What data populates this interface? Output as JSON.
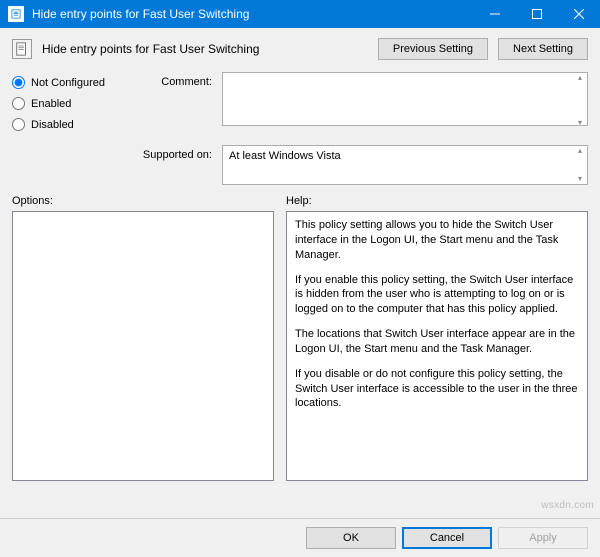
{
  "window": {
    "title": "Hide entry points for Fast User Switching"
  },
  "header": {
    "page_title": "Hide entry points for Fast User Switching",
    "previous": "Previous Setting",
    "next": "Next Setting"
  },
  "state": {
    "not_configured": "Not Configured",
    "enabled": "Enabled",
    "disabled": "Disabled",
    "selected": "not_configured"
  },
  "labels": {
    "comment": "Comment:",
    "supported_on": "Supported on:",
    "options": "Options:",
    "help": "Help:"
  },
  "fields": {
    "comment": "",
    "supported_on": "At least Windows Vista"
  },
  "help": {
    "p1": "This policy setting allows you to hide the Switch User interface in the Logon UI, the Start menu and the Task Manager.",
    "p2": "If you enable this policy setting, the Switch User interface is hidden from the user who is attempting to log on or is logged on to the computer that has this policy applied.",
    "p3": "The locations that Switch User interface appear are in the Logon UI, the Start menu and the Task Manager.",
    "p4": "If you disable or do not configure this policy setting, the Switch User interface is accessible to the user in the three locations."
  },
  "footer": {
    "ok": "OK",
    "cancel": "Cancel",
    "apply": "Apply"
  },
  "watermark": "wsxdn.com"
}
